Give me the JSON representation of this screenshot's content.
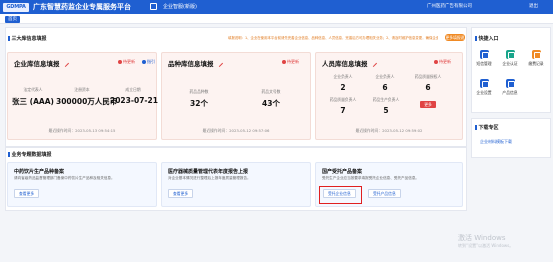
{
  "header": {
    "logo": "GDMPA",
    "title": "广东智慧药监企业专属服务平台",
    "portal_tag": "企业智服(新版)",
    "user": "广州医药广告有限公司",
    "logout": "退出"
  },
  "tabs": [
    {
      "label": "首页"
    }
  ],
  "top_section": {
    "title": "三大库信息填报",
    "notice": "填报说明：1、企业在使用本平台前请先完善企业信息、品种信息、人员信息，完善后方可办理相关业务；2、请及时维护信息变更，确保企业信息真实有效。",
    "more_button": "更多填报说明"
  },
  "cards": [
    {
      "title": "企业库信息填报",
      "link_red": "待更新",
      "link_blue": "指引",
      "stats": [
        {
          "label": "法定代表人",
          "value": "张三 (AAA)"
        },
        {
          "label": "注册资本",
          "value": "300000万人民币"
        },
        {
          "label": "成立日期",
          "value": "2023-07-21"
        }
      ],
      "footer": "最近操作时间：2023-05-13 09:54:15"
    },
    {
      "title": "品种库信息填报",
      "link_red": "待更新",
      "stats": [
        {
          "label": "药品品种数",
          "value": "32个"
        },
        {
          "label": "药品文号数",
          "value": "43个"
        }
      ],
      "footer": "最近操作时间：2023-05-12 09:57:06"
    },
    {
      "title": "人员库信息填报",
      "link_red": "待更新",
      "stats": [
        {
          "label": "企业负责人",
          "value": "2"
        },
        {
          "label": "企业负责人",
          "value": "6"
        },
        {
          "label": "药品质量授权人",
          "value": "6"
        },
        {
          "label": "药品质量负责人",
          "value": "7"
        },
        {
          "label": "药品生产负责人",
          "value": "5"
        }
      ],
      "more": "更多",
      "footer": "最近操作时间：2023-05-12 09:59:02"
    }
  ],
  "business_section": {
    "title": "业务专题数据填报",
    "items": [
      {
        "title": "中药饮片生产品种备案",
        "desc": "请向省级药品监督管理部门备案中药饮片生产品种及相关信息。",
        "buttons": [
          "查看更多"
        ]
      },
      {
        "title": "医疗器械质量管理代表年度报告上报",
        "desc": "对企业基本情况进行整理后上报年度质量管理报告。",
        "buttons": [
          "查看更多"
        ]
      },
      {
        "title": "国产受托产品备案",
        "desc": "受托生产企业应当按要求填报受托企业信息、受托产品信息。",
        "buttons": [
          "受托企业信息",
          "受托产品信息"
        ]
      }
    ]
  },
  "quick_entry": {
    "title": "快捷入口",
    "items": [
      {
        "label": "短信管理",
        "icon": "message-icon"
      },
      {
        "label": "企业认证",
        "icon": "certification-icon"
      },
      {
        "label": "缴费记录",
        "icon": "payment-icon"
      },
      {
        "label": "企业设置",
        "icon": "settings-icon"
      },
      {
        "label": "产品信息",
        "icon": "product-icon"
      }
    ]
  },
  "download": {
    "title": "下载专区",
    "link": "企业材料模板下载"
  },
  "watermark": {
    "line1": "激活 Windows",
    "line2": "转到“设置”以激活 Windows。"
  },
  "colors": {
    "primary": "#1f5fd1",
    "accent_orange": "#f08a24",
    "alert_red": "#e04444"
  }
}
